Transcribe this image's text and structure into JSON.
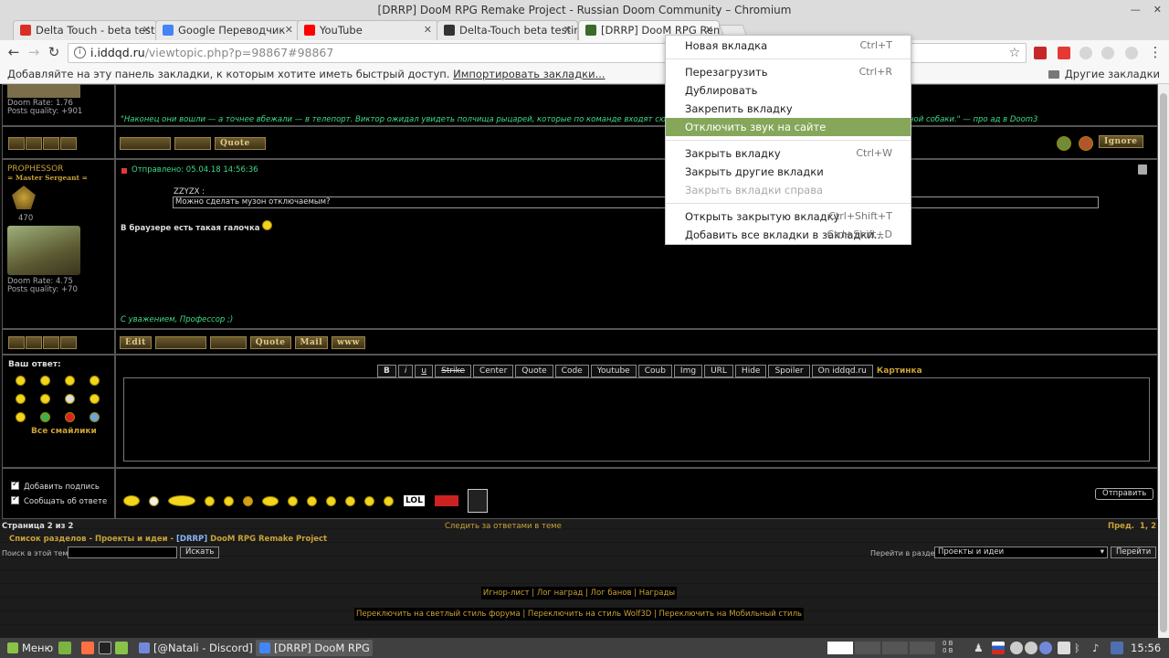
{
  "window": {
    "title": "[DRRP] DooM RPG Remake Project - Russian Doom Community – Chromium"
  },
  "tabs": [
    {
      "label": "Delta Touch - beta testin",
      "color": "#d93025"
    },
    {
      "label": "Google Переводчик",
      "color": "#4285f4"
    },
    {
      "label": "YouTube",
      "color": "#ff0000"
    },
    {
      "label": "Delta-Touch beta testin",
      "color": "#333333"
    },
    {
      "label": "[DRRP] DooM RPG Rem",
      "color": "#3a6b2a"
    }
  ],
  "toolbar": {
    "url_host": "i.iddqd.ru",
    "url_rest": "/viewtopic.php?p=98867#98867"
  },
  "bookmarks": {
    "hint": "Добавляйте на эту панель закладки, к которым хотите иметь быстрый доступ.",
    "import_link": "Импортировать закладки...",
    "other": "Другие закладки"
  },
  "post1": {
    "rate": "Doom Rate: 1.76",
    "quality": "Posts quality: +901",
    "signature": "\"Наконец они вошли — а точнее вбежали — в телепорт. Виктор ожидал увидеть полчища рыцарей, которые по команде входят сюда и появляются в",
    "signature_end": "ной собаки.\" — про ад в Doom3",
    "ignore_label": "Ignore"
  },
  "post2": {
    "author": "PROPHESSOR",
    "rank": "= Master Sergeant =",
    "posts": "470",
    "rate": "Doom Rate: 4.75",
    "quality": "Posts quality: +70",
    "sent": "Отправлено: 05.04.18 14:56:36",
    "quote_author": "ZZYZX :",
    "quote_text": "Можно сделать музон отключаемым?",
    "body": "В браузере есть такая галочка",
    "signature": "С уважением, Профессор ;)"
  },
  "reply": {
    "label": "Ваш ответ:",
    "all_smileys": "Все смайлики",
    "format_buttons": [
      "B",
      "i",
      "u",
      "Strike",
      "Center",
      "Quote",
      "Code",
      "Youtube",
      "Coub",
      "Img",
      "URL",
      "Hide",
      "Spoiler",
      "On iddqd.ru"
    ],
    "picture_link": "Картинка",
    "opt_signature": "Добавить подпись",
    "opt_notify": "Сообщать об ответе",
    "send_button": "Отправить",
    "lol": "LOL"
  },
  "footer": {
    "page_info": "Страница 2 из 2",
    "follow": "Следить за ответами в теме",
    "prev": "Пред.",
    "pages": "1, 2",
    "crumbs_1": "Список разделов - Проекты и идеи -",
    "crumbs_2": "[DRRP]",
    "crumbs_3": "DooM RPG Remake Project",
    "search_label": "Поиск в этой теме:",
    "search_button": "Искать",
    "goto_label": "Перейти в раздел:",
    "goto_value": "Проекты и идеи",
    "goto_button": "Перейти",
    "links_1": "Игнор-лист | Лог наград | Лог банов | Награды",
    "links_2": "Переключить на светлый стиль форума | Переключить на стиль Wolf3D | Переключить на Мобильный стиль"
  },
  "context_menu": [
    {
      "label": "Новая вкладка",
      "shortcut": "Ctrl+T"
    },
    {
      "label": "Перезагрузить",
      "shortcut": "Ctrl+R"
    },
    {
      "label": "Дублировать",
      "shortcut": ""
    },
    {
      "label": "Закрепить вкладку",
      "shortcut": ""
    },
    {
      "label": "Отключить звук на сайте",
      "shortcut": ""
    },
    {
      "label": "Закрыть вкладку",
      "shortcut": "Ctrl+W"
    },
    {
      "label": "Закрыть другие вкладки",
      "shortcut": ""
    },
    {
      "label": "Закрыть вкладки справа",
      "shortcut": ""
    },
    {
      "label": "Открыть закрытую вкладку",
      "shortcut": "Ctrl+Shift+T"
    },
    {
      "label": "Добавить все вкладки в закладки...",
      "shortcut": "Ctrl+Shift+D"
    }
  ],
  "taskbar": {
    "menu": "Меню",
    "discord": "[@Natali - Discord]",
    "chromium": "[DRRP] DooM RPG R...",
    "time": "15:56",
    "net_up": "0 B",
    "net_down": "0 B"
  },
  "colors": {
    "accent": "#c9a236",
    "highlight": "#86a75a",
    "green_text": "#3ddc84"
  }
}
